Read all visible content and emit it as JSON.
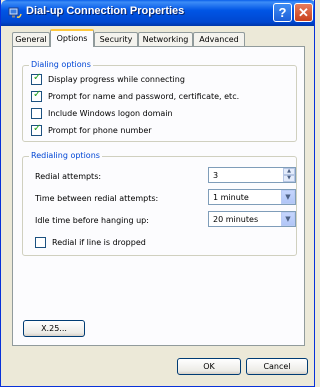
{
  "window": {
    "title": "Dial-up Connection Properties"
  },
  "titlebar": {
    "help_glyph": "?",
    "close_glyph": "✕"
  },
  "tabs": [
    "General",
    "Options",
    "Security",
    "Networking",
    "Advanced"
  ],
  "dialing": {
    "legend": "Dialing options",
    "items": [
      {
        "label": "Display progress while connecting",
        "checked": true
      },
      {
        "label": "Prompt for name and password, certificate, etc.",
        "checked": true
      },
      {
        "label": "Include Windows logon domain",
        "checked": false
      },
      {
        "label": "Prompt for phone number",
        "checked": true
      }
    ]
  },
  "redialing": {
    "legend": "Redialing options",
    "attempts_label": "Redial attempts:",
    "attempts_value": "3",
    "time_label": "Time between redial attempts:",
    "time_value": "1 minute",
    "idle_label": "Idle time before hanging up:",
    "idle_value": "20 minutes",
    "redial_dropped_label": "Redial if line is dropped",
    "redial_dropped_checked": false
  },
  "x25_button": "X.25...",
  "ok_button": "OK",
  "cancel_button": "Cancel",
  "colors": {
    "title_blue": "#0055e5",
    "group_legend": "#0046d5",
    "tab_highlight": "#ffc83c"
  }
}
